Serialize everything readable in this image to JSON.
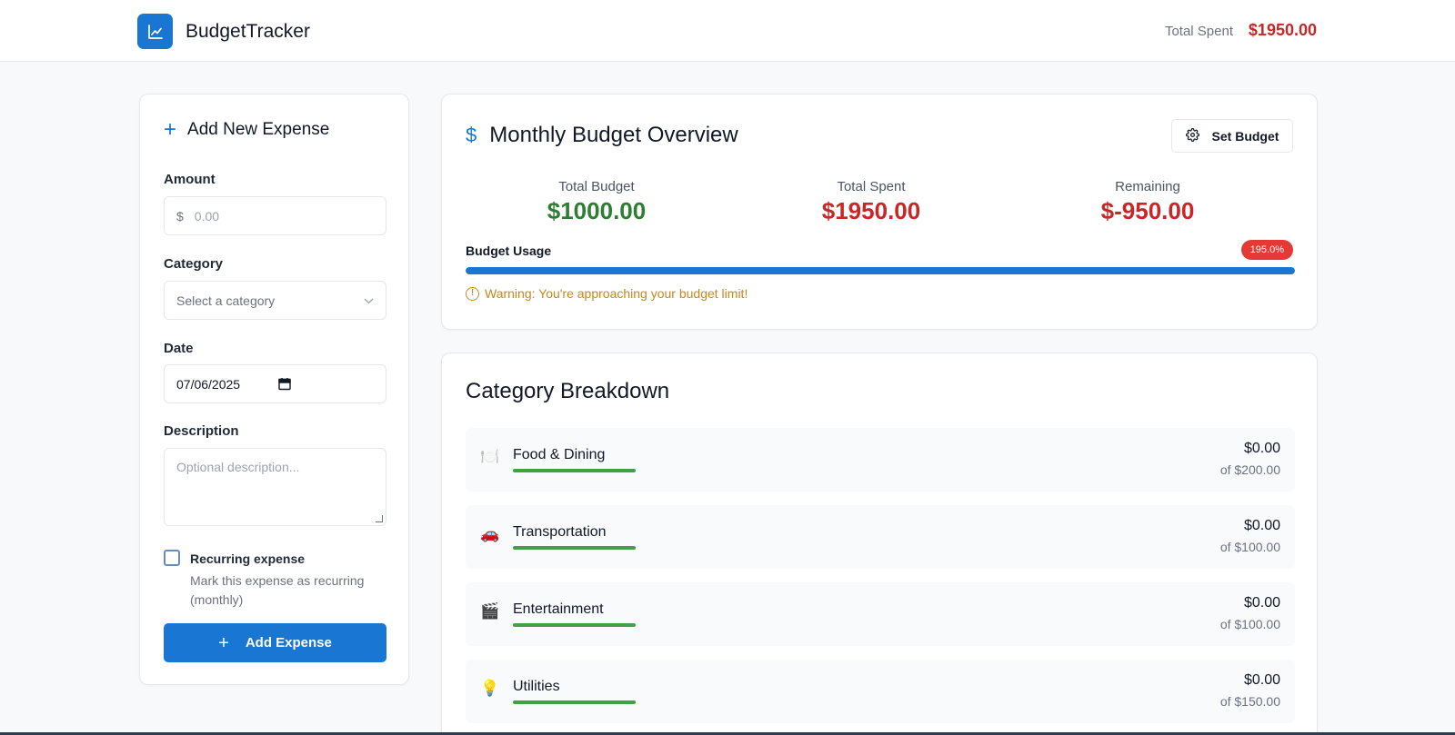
{
  "header": {
    "app_title": "BudgetTracker",
    "total_spent_label": "Total Spent",
    "total_spent_value": "$1950.00"
  },
  "form": {
    "title": "Add New Expense",
    "amount_label": "Amount",
    "amount_prefix": "$",
    "amount_placeholder": "0.00",
    "category_label": "Category",
    "category_placeholder": "Select a category",
    "date_label": "Date",
    "date_value": "07/06/2025",
    "description_label": "Description",
    "description_placeholder": "Optional description...",
    "recurring_label": "Recurring expense",
    "recurring_help": "Mark this expense as recurring (monthly)",
    "submit_label": "Add Expense"
  },
  "overview": {
    "title": "Monthly Budget Overview",
    "set_budget_label": "Set Budget",
    "stats": [
      {
        "label": "Total Budget",
        "value": "$1000.00"
      },
      {
        "label": "Total Spent",
        "value": "$1950.00"
      },
      {
        "label": "Remaining",
        "value": "$-950.00"
      }
    ],
    "usage_label": "Budget Usage",
    "usage_badge": "195.0%",
    "usage_fill_percent": 100,
    "warning_text": "Warning: You're approaching your budget limit!"
  },
  "breakdown": {
    "title": "Category Breakdown",
    "categories": [
      {
        "icon": "plate-icon",
        "glyph": "🍽️",
        "name": "Food & Dining",
        "amount": "$0.00",
        "limit": "of $200.00",
        "fill_percent": 0
      },
      {
        "icon": "car-icon",
        "glyph": "🚗",
        "name": "Transportation",
        "amount": "$0.00",
        "limit": "of $100.00",
        "fill_percent": 0
      },
      {
        "icon": "clapper-icon",
        "glyph": "🎬",
        "name": "Entertainment",
        "amount": "$0.00",
        "limit": "of $100.00",
        "fill_percent": 0
      },
      {
        "icon": "lightbulb-icon",
        "glyph": "💡",
        "name": "Utilities",
        "amount": "$0.00",
        "limit": "of $150.00",
        "fill_percent": 0
      }
    ]
  },
  "colors": {
    "accent": "#1976d2",
    "positive": "#2e7d32",
    "negative": "#c62828",
    "warning": "#c9871a",
    "badge": "#e53935",
    "category_bar": "#43a047"
  }
}
